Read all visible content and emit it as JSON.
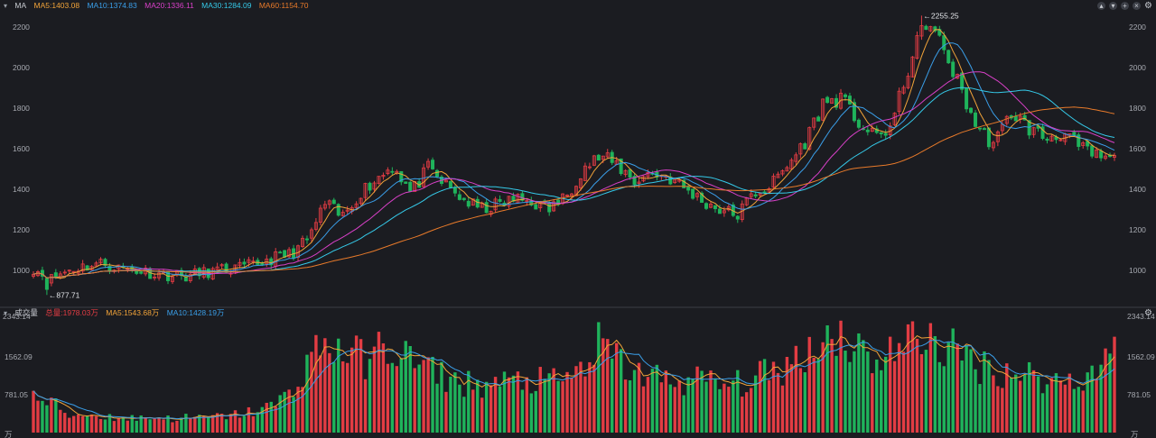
{
  "header": {
    "title": "MA",
    "ma": [
      {
        "label": "MA5:1403.08",
        "color": "#f1a339"
      },
      {
        "label": "MA10:1374.83",
        "color": "#3a9ee8"
      },
      {
        "label": "MA20:1336.11",
        "color": "#d940c8"
      },
      {
        "label": "MA30:1284.09",
        "color": "#35c9e8"
      },
      {
        "label": "MA60:1154.70",
        "color": "#e87a2a"
      }
    ]
  },
  "volume_header": {
    "title": "成交量",
    "items": [
      {
        "label": "总量:1978.03万",
        "color": "#e23c43"
      },
      {
        "label": "MA5:1543.68万",
        "color": "#f1a339"
      },
      {
        "label": "MA10:1428.19万",
        "color": "#3a9ee8"
      }
    ]
  },
  "colors": {
    "up": "#e23c43",
    "down": "#1fb35b",
    "background": "#1b1c21",
    "axis_text": "#a6a9b0"
  },
  "chart_data": [
    {
      "type": "candlestick",
      "title": "MA",
      "ylim": [
        830,
        2270
      ],
      "y_ticks": [
        "2200",
        "2000",
        "1800",
        "1600",
        "1400",
        "1200",
        "1000"
      ],
      "annotations": [
        {
          "text": "←2255.25",
          "value": 2255.25
        },
        {
          "text": "←877.71",
          "value": 877.71
        }
      ],
      "close_path": [
        1010,
        955,
        1000,
        1020,
        1035,
        1010,
        1000,
        985,
        975,
        970,
        990,
        1000,
        1010,
        1030,
        1060,
        1080,
        1150,
        1330,
        1260,
        1380,
        1450,
        1520,
        1380,
        1500,
        1420,
        1350,
        1300,
        1320,
        1350,
        1340,
        1300,
        1360,
        1500,
        1560,
        1520,
        1440,
        1480,
        1460,
        1400,
        1340,
        1300,
        1270,
        1380,
        1420,
        1520,
        1640,
        1820,
        1850,
        1740,
        1650,
        1710,
        2000,
        2230,
        2100,
        1900,
        1700,
        1620,
        1780,
        1700,
        1650,
        1680,
        1600,
        1560,
        1540
      ],
      "overlays": [
        {
          "name": "MA5",
          "color": "#f1a339"
        },
        {
          "name": "MA10",
          "color": "#3a9ee8"
        },
        {
          "name": "MA20",
          "color": "#d940c8"
        },
        {
          "name": "MA30",
          "color": "#35c9e8"
        },
        {
          "name": "MA60",
          "color": "#e87a2a"
        }
      ]
    },
    {
      "type": "bar",
      "title": "成交量",
      "ylim": [
        0,
        2343.14
      ],
      "y_ticks": [
        "2343.14",
        "1562.09",
        "781.05",
        "万"
      ],
      "volume_path": [
        700,
        640,
        360,
        380,
        340,
        310,
        300,
        320,
        290,
        310,
        300,
        340,
        380,
        460,
        560,
        820,
        1500,
        1850,
        1700,
        1520,
        1650,
        1780,
        1500,
        1300,
        1150,
        1030,
        980,
        1000,
        1050,
        1080,
        1020,
        1100,
        1320,
        1800,
        1500,
        1250,
        1150,
        1100,
        1050,
        1120,
        980,
        1000,
        1100,
        1250,
        1400,
        1700,
        1950,
        2100,
        1750,
        1550,
        1650,
        1850,
        2050,
        1800,
        1600,
        1450,
        1300,
        1250,
        1200,
        1100,
        1050,
        1150,
        1250,
        1978
      ],
      "overlays": [
        {
          "name": "MA5",
          "color": "#f1a339"
        },
        {
          "name": "MA10",
          "color": "#3a9ee8"
        }
      ]
    }
  ]
}
